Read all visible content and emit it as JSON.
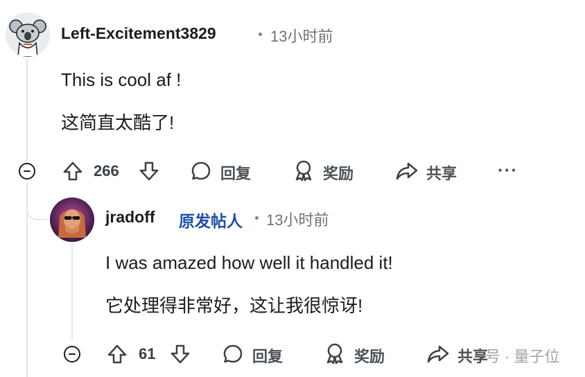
{
  "comment": {
    "username": "Left-Excitement3829",
    "time": "13小时前",
    "text_en": "This is cool af !",
    "text_zh": "这简直太酷了!",
    "upvotes": "266",
    "reply_label": "回复",
    "award_label": "奖励",
    "share_label": "共享",
    "more_label": "···"
  },
  "reply": {
    "username": "jradoff",
    "op_badge": "原发帖人",
    "time": "13小时前",
    "text_en": "I was amazed how well it handled it!",
    "text_zh": "它处理得非常好，这让我很惊讶!",
    "upvotes": "61",
    "reply_label": "回复",
    "award_label": "奖励",
    "share_label": "共享"
  },
  "watermark": {
    "text": "号 · 量子位"
  },
  "colors": {
    "accent_op": "#1e4fa8",
    "text": "#1c1c1c",
    "muted": "#6d7278"
  }
}
